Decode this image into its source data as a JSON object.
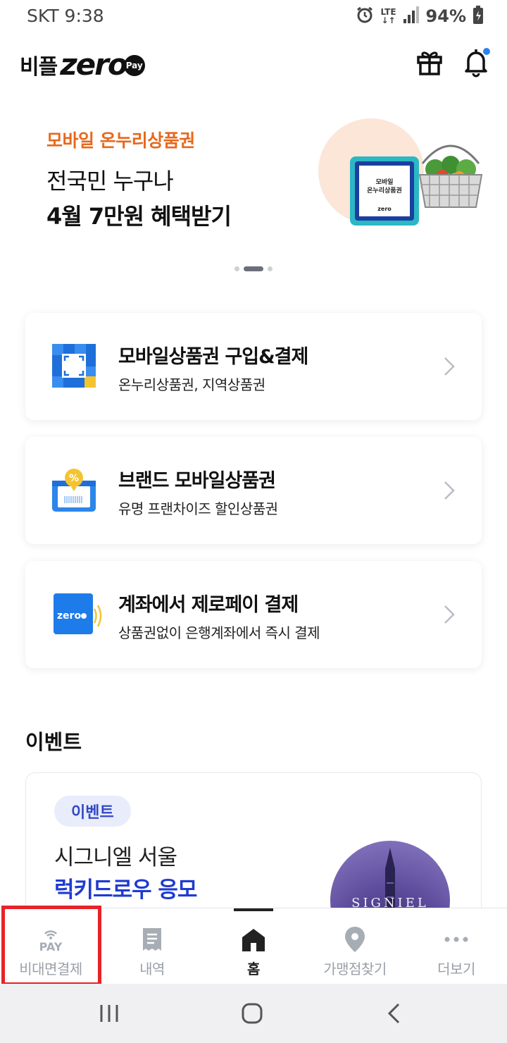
{
  "status_bar": {
    "carrier_time": "SKT 9:38",
    "network": "LTE",
    "battery": "94%"
  },
  "header": {
    "logo_korean": "비플",
    "logo_zero": "zero",
    "logo_pay": "Pay",
    "icons": [
      "gift-icon",
      "bell-icon"
    ]
  },
  "banner": {
    "tag": "모바일 온누리상품권",
    "line1": "전국민 누구나",
    "line2": "4월 7만원 혜택받기",
    "voucher_text_1": "모바일",
    "voucher_text_2": "온누리상품권",
    "voucher_brand": "zero",
    "page_count": 3,
    "active_page": 2
  },
  "menu": {
    "items": [
      {
        "title": "모바일상품권 구입&결제",
        "subtitle": "온누리상품권, 지역상품권",
        "icon": "voucher-scan-icon"
      },
      {
        "title": "브랜드 모바일상품권",
        "subtitle": "유명 프랜차이즈 할인상품권",
        "icon": "discount-coupon-icon"
      },
      {
        "title": "계좌에서 제로페이 결제",
        "subtitle": "상품권없이 은행계좌에서 즉시 결제",
        "icon": "zero-card-icon"
      }
    ],
    "card_icon_zero_label": "zero",
    "coupon_percent": "%"
  },
  "events": {
    "section_title": "이벤트",
    "badge": "이벤트",
    "line1": "시그니엘 서울",
    "line2": "럭키드로우 응모",
    "image_text": "SIGNIEL"
  },
  "bottom_nav": {
    "items": [
      {
        "label": "비대면결제",
        "icon": "pay-wifi-icon",
        "icon_text": "PAY"
      },
      {
        "label": "내역",
        "icon": "receipt-icon"
      },
      {
        "label": "홈",
        "icon": "home-icon"
      },
      {
        "label": "가맹점찾기",
        "icon": "location-pin-icon"
      },
      {
        "label": "더보기",
        "icon": "more-dots-icon"
      }
    ],
    "active_index": 2,
    "highlighted_index": 0
  },
  "system_nav": {
    "icons": [
      "recent-apps-icon",
      "home-circle-icon",
      "back-icon"
    ]
  },
  "colors": {
    "accent_orange": "#e7681c",
    "event_blue": "#1f3bd1",
    "highlight_red": "#e8222a",
    "notification_dot": "#2a82f5"
  }
}
